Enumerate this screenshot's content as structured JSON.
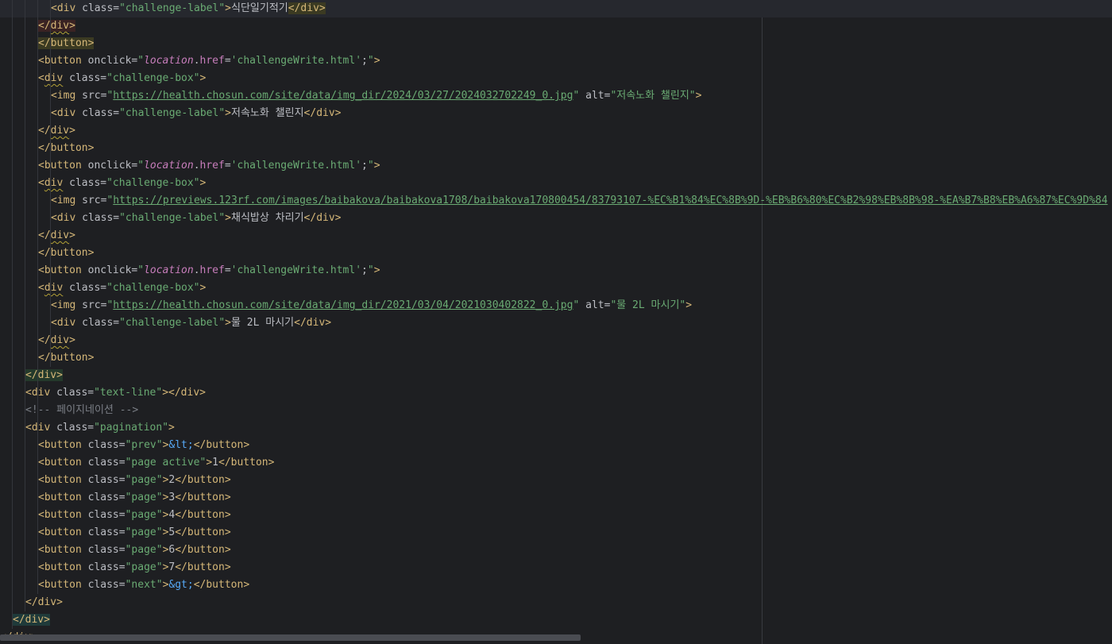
{
  "editor": {
    "lines": [
      {
        "indent": 4,
        "current": true,
        "tokens": [
          {
            "t": "tag",
            "v": "<div "
          },
          {
            "t": "attr",
            "v": "class="
          },
          {
            "t": "val",
            "v": "\"challenge-label\""
          },
          {
            "t": "tag",
            "v": ">"
          },
          {
            "t": "text",
            "v": "식단일기적기"
          },
          {
            "t": "tag",
            "v": "</div>",
            "hl": "olive"
          }
        ]
      },
      {
        "indent": 3,
        "tokens": [
          {
            "t": "tag",
            "v": "</",
            "hl": "red"
          },
          {
            "t": "tag",
            "v": "div",
            "hl": "red",
            "wavy": true
          },
          {
            "t": "tag",
            "v": ">",
            "hl": "red"
          }
        ]
      },
      {
        "indent": 3,
        "tokens": [
          {
            "t": "tag",
            "v": "</button>",
            "hl": "olive"
          }
        ]
      },
      {
        "indent": 3,
        "tokens": [
          {
            "t": "tag",
            "v": "<button "
          },
          {
            "t": "attr",
            "v": "onclick="
          },
          {
            "t": "val",
            "v": "\""
          },
          {
            "t": "js",
            "v": "location"
          },
          {
            "t": "attr",
            "v": "."
          },
          {
            "t": "prop",
            "v": "href"
          },
          {
            "t": "attr",
            "v": "="
          },
          {
            "t": "str",
            "v": "'challengeWrite.html'"
          },
          {
            "t": "attr",
            "v": ";"
          },
          {
            "t": "val",
            "v": "\""
          },
          {
            "t": "tag",
            "v": ">"
          }
        ]
      },
      {
        "indent": 3,
        "tokens": [
          {
            "t": "tag",
            "v": "<"
          },
          {
            "t": "tag",
            "v": "div",
            "wavy": true
          },
          {
            "t": "tag",
            "v": " "
          },
          {
            "t": "attr",
            "v": "class="
          },
          {
            "t": "val",
            "v": "\"challenge-box\""
          },
          {
            "t": "tag",
            "v": ">"
          }
        ]
      },
      {
        "indent": 4,
        "tokens": [
          {
            "t": "tag",
            "v": "<img "
          },
          {
            "t": "attr",
            "v": "src="
          },
          {
            "t": "val",
            "v": "\""
          },
          {
            "t": "link",
            "v": "https://health.chosun.com/site/data/img_dir/2024/03/27/2024032702249_0.jpg"
          },
          {
            "t": "val",
            "v": "\""
          },
          {
            "t": "attr",
            "v": " alt="
          },
          {
            "t": "val",
            "v": "\"저속노화 챌린지\""
          },
          {
            "t": "tag",
            "v": ">"
          }
        ]
      },
      {
        "indent": 4,
        "tokens": [
          {
            "t": "tag",
            "v": "<div "
          },
          {
            "t": "attr",
            "v": "class="
          },
          {
            "t": "val",
            "v": "\"challenge-label\""
          },
          {
            "t": "tag",
            "v": ">"
          },
          {
            "t": "text",
            "v": "저속노화 챌린지"
          },
          {
            "t": "tag",
            "v": "</div>"
          }
        ]
      },
      {
        "indent": 3,
        "tokens": [
          {
            "t": "tag",
            "v": "</"
          },
          {
            "t": "tag",
            "v": "div",
            "wavy": true
          },
          {
            "t": "tag",
            "v": ">"
          }
        ]
      },
      {
        "indent": 3,
        "tokens": [
          {
            "t": "tag",
            "v": "</button>"
          }
        ]
      },
      {
        "indent": 3,
        "tokens": [
          {
            "t": "tag",
            "v": "<button "
          },
          {
            "t": "attr",
            "v": "onclick="
          },
          {
            "t": "val",
            "v": "\""
          },
          {
            "t": "js",
            "v": "location"
          },
          {
            "t": "attr",
            "v": "."
          },
          {
            "t": "prop",
            "v": "href"
          },
          {
            "t": "attr",
            "v": "="
          },
          {
            "t": "str",
            "v": "'challengeWrite.html'"
          },
          {
            "t": "attr",
            "v": ";"
          },
          {
            "t": "val",
            "v": "\""
          },
          {
            "t": "tag",
            "v": ">"
          }
        ]
      },
      {
        "indent": 3,
        "tokens": [
          {
            "t": "tag",
            "v": "<"
          },
          {
            "t": "tag",
            "v": "div",
            "wavy": true
          },
          {
            "t": "tag",
            "v": " "
          },
          {
            "t": "attr",
            "v": "class="
          },
          {
            "t": "val",
            "v": "\"challenge-box\""
          },
          {
            "t": "tag",
            "v": ">"
          }
        ]
      },
      {
        "indent": 4,
        "tokens": [
          {
            "t": "tag",
            "v": "<img "
          },
          {
            "t": "attr",
            "v": "src="
          },
          {
            "t": "val",
            "v": "\""
          },
          {
            "t": "link",
            "v": "https://previews.123rf.com/images/baibakova/baibakova1708/baibakova170800454/83793107-%EC%B1%84%EC%8B%9D-%EB%B6%80%EC%B2%98%EB%8B%98-%EA%B7%B8%EB%A6%87%EC%9D%84"
          }
        ]
      },
      {
        "indent": 4,
        "tokens": [
          {
            "t": "tag",
            "v": "<div "
          },
          {
            "t": "attr",
            "v": "class="
          },
          {
            "t": "val",
            "v": "\"challenge-label\""
          },
          {
            "t": "tag",
            "v": ">"
          },
          {
            "t": "text",
            "v": "채식밥상 차리기"
          },
          {
            "t": "tag",
            "v": "</div>"
          }
        ]
      },
      {
        "indent": 3,
        "tokens": [
          {
            "t": "tag",
            "v": "</"
          },
          {
            "t": "tag",
            "v": "div",
            "wavy": true
          },
          {
            "t": "tag",
            "v": ">"
          }
        ]
      },
      {
        "indent": 3,
        "tokens": [
          {
            "t": "tag",
            "v": "</button>"
          }
        ]
      },
      {
        "indent": 3,
        "tokens": [
          {
            "t": "tag",
            "v": "<button "
          },
          {
            "t": "attr",
            "v": "onclick="
          },
          {
            "t": "val",
            "v": "\""
          },
          {
            "t": "js",
            "v": "location"
          },
          {
            "t": "attr",
            "v": "."
          },
          {
            "t": "prop",
            "v": "href"
          },
          {
            "t": "attr",
            "v": "="
          },
          {
            "t": "str",
            "v": "'challengeWrite.html'"
          },
          {
            "t": "attr",
            "v": ";"
          },
          {
            "t": "val",
            "v": "\""
          },
          {
            "t": "tag",
            "v": ">"
          }
        ]
      },
      {
        "indent": 3,
        "tokens": [
          {
            "t": "tag",
            "v": "<"
          },
          {
            "t": "tag",
            "v": "div",
            "wavy": true
          },
          {
            "t": "tag",
            "v": " "
          },
          {
            "t": "attr",
            "v": "class="
          },
          {
            "t": "val",
            "v": "\"challenge-box\""
          },
          {
            "t": "tag",
            "v": ">"
          }
        ]
      },
      {
        "indent": 4,
        "tokens": [
          {
            "t": "tag",
            "v": "<img "
          },
          {
            "t": "attr",
            "v": "src="
          },
          {
            "t": "val",
            "v": "\""
          },
          {
            "t": "link",
            "v": "https://health.chosun.com/site/data/img_dir/2021/03/04/2021030402822_0.jpg"
          },
          {
            "t": "val",
            "v": "\""
          },
          {
            "t": "attr",
            "v": " alt="
          },
          {
            "t": "val",
            "v": "\"물 2L 마시기\""
          },
          {
            "t": "tag",
            "v": ">"
          }
        ]
      },
      {
        "indent": 4,
        "tokens": [
          {
            "t": "tag",
            "v": "<div "
          },
          {
            "t": "attr",
            "v": "class="
          },
          {
            "t": "val",
            "v": "\"challenge-label\""
          },
          {
            "t": "tag",
            "v": ">"
          },
          {
            "t": "text",
            "v": "물 2L 마시기"
          },
          {
            "t": "tag",
            "v": "</div>"
          }
        ]
      },
      {
        "indent": 3,
        "tokens": [
          {
            "t": "tag",
            "v": "</"
          },
          {
            "t": "tag",
            "v": "div",
            "wavy": true
          },
          {
            "t": "tag",
            "v": ">"
          }
        ]
      },
      {
        "indent": 3,
        "tokens": [
          {
            "t": "tag",
            "v": "</button>"
          }
        ]
      },
      {
        "indent": 2,
        "tokens": [
          {
            "t": "tag",
            "v": "</div>",
            "hl": "green"
          }
        ]
      },
      {
        "indent": 2,
        "tokens": [
          {
            "t": "tag",
            "v": "<div "
          },
          {
            "t": "attr",
            "v": "class="
          },
          {
            "t": "val",
            "v": "\"text-line\""
          },
          {
            "t": "tag",
            "v": "></div>"
          }
        ]
      },
      {
        "indent": 2,
        "tokens": [
          {
            "t": "comment",
            "v": "<!-- 페이지네이션 -->"
          }
        ]
      },
      {
        "indent": 2,
        "tokens": [
          {
            "t": "tag",
            "v": "<div "
          },
          {
            "t": "attr",
            "v": "class="
          },
          {
            "t": "val",
            "v": "\"pagination\""
          },
          {
            "t": "tag",
            "v": ">"
          }
        ]
      },
      {
        "indent": 3,
        "tokens": [
          {
            "t": "tag",
            "v": "<button "
          },
          {
            "t": "attr",
            "v": "class="
          },
          {
            "t": "val",
            "v": "\"prev\""
          },
          {
            "t": "tag",
            "v": ">"
          },
          {
            "t": "ent",
            "v": "&lt;"
          },
          {
            "t": "tag",
            "v": "</button>"
          }
        ]
      },
      {
        "indent": 3,
        "tokens": [
          {
            "t": "tag",
            "v": "<button "
          },
          {
            "t": "attr",
            "v": "class="
          },
          {
            "t": "val",
            "v": "\"page active\""
          },
          {
            "t": "tag",
            "v": ">"
          },
          {
            "t": "text",
            "v": "1"
          },
          {
            "t": "tag",
            "v": "</button>"
          }
        ]
      },
      {
        "indent": 3,
        "tokens": [
          {
            "t": "tag",
            "v": "<button "
          },
          {
            "t": "attr",
            "v": "class="
          },
          {
            "t": "val",
            "v": "\"page\""
          },
          {
            "t": "tag",
            "v": ">"
          },
          {
            "t": "text",
            "v": "2"
          },
          {
            "t": "tag",
            "v": "</button>"
          }
        ]
      },
      {
        "indent": 3,
        "tokens": [
          {
            "t": "tag",
            "v": "<button "
          },
          {
            "t": "attr",
            "v": "class="
          },
          {
            "t": "val",
            "v": "\"page\""
          },
          {
            "t": "tag",
            "v": ">"
          },
          {
            "t": "text",
            "v": "3"
          },
          {
            "t": "tag",
            "v": "</button>"
          }
        ]
      },
      {
        "indent": 3,
        "tokens": [
          {
            "t": "tag",
            "v": "<button "
          },
          {
            "t": "attr",
            "v": "class="
          },
          {
            "t": "val",
            "v": "\"page\""
          },
          {
            "t": "tag",
            "v": ">"
          },
          {
            "t": "text",
            "v": "4"
          },
          {
            "t": "tag",
            "v": "</button>"
          }
        ]
      },
      {
        "indent": 3,
        "tokens": [
          {
            "t": "tag",
            "v": "<button "
          },
          {
            "t": "attr",
            "v": "class="
          },
          {
            "t": "val",
            "v": "\"page\""
          },
          {
            "t": "tag",
            "v": ">"
          },
          {
            "t": "text",
            "v": "5"
          },
          {
            "t": "tag",
            "v": "</button>"
          }
        ]
      },
      {
        "indent": 3,
        "tokens": [
          {
            "t": "tag",
            "v": "<button "
          },
          {
            "t": "attr",
            "v": "class="
          },
          {
            "t": "val",
            "v": "\"page\""
          },
          {
            "t": "tag",
            "v": ">"
          },
          {
            "t": "text",
            "v": "6"
          },
          {
            "t": "tag",
            "v": "</button>"
          }
        ]
      },
      {
        "indent": 3,
        "tokens": [
          {
            "t": "tag",
            "v": "<button "
          },
          {
            "t": "attr",
            "v": "class="
          },
          {
            "t": "val",
            "v": "\"page\""
          },
          {
            "t": "tag",
            "v": ">"
          },
          {
            "t": "text",
            "v": "7"
          },
          {
            "t": "tag",
            "v": "</button>"
          }
        ]
      },
      {
        "indent": 3,
        "tokens": [
          {
            "t": "tag",
            "v": "<button "
          },
          {
            "t": "attr",
            "v": "class="
          },
          {
            "t": "val",
            "v": "\"next\""
          },
          {
            "t": "tag",
            "v": ">"
          },
          {
            "t": "ent",
            "v": "&gt;"
          },
          {
            "t": "tag",
            "v": "</button>"
          }
        ]
      },
      {
        "indent": 2,
        "tokens": [
          {
            "t": "tag",
            "v": "</div>"
          }
        ]
      },
      {
        "indent": 1,
        "tokens": [
          {
            "t": "tag",
            "v": "</div>",
            "hl": "teal"
          }
        ]
      },
      {
        "indent": 0,
        "tokens": [
          {
            "t": "tag",
            "v": "</div>"
          }
        ]
      }
    ]
  },
  "colors": {
    "background": "#1e1f22",
    "tag": "#d5b778",
    "attribute": "#bcbec4",
    "string": "#6aab73",
    "js_keyword": "#c77dbb",
    "entity": "#56a8f5",
    "comment": "#7a7e85"
  },
  "icons": {
    "gutter": "lightbulb-icon"
  }
}
